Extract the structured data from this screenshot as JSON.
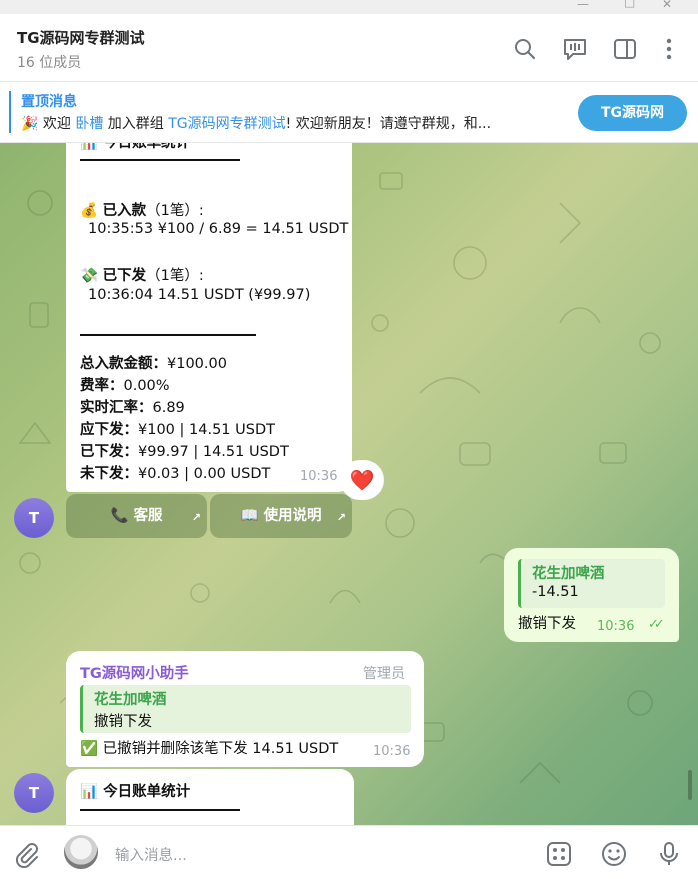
{
  "header": {
    "title": "TG源码网专群测试",
    "subtitle": "16 位成员"
  },
  "pinned": {
    "title": "置顶消息",
    "emoji": "🎉",
    "text_prefix": "欢迎",
    "user": "卧槽",
    "text_mid": "加入群组",
    "group": "TG源码网专群测试",
    "text_suffix": "!   欢迎新朋友！请遵守群规，和...",
    "button": "TG源码网"
  },
  "bill1": {
    "title_partial": "今日账单统计",
    "deposit_emoji": "💰",
    "deposit_label": "已入款",
    "deposit_count": "（1笔）:",
    "deposit_entry": "10:35:53 ¥100 / 6.89 = 14.51 USDT",
    "payout_emoji": "💸",
    "payout_label": "已下发",
    "payout_count": "（1笔）:",
    "payout_entry": "10:36:04 14.51 USDT (¥99.97)",
    "total_label": "总入款金额：",
    "total_value": "¥100.00",
    "rate_label": "费率：",
    "rate_value": "0.00%",
    "fx_label": "实时汇率：",
    "fx_value": "6.89",
    "due_label": "应下发：",
    "due_value": "¥100 | 14.51 USDT",
    "paid_label": "已下发：",
    "paid_value": "¥99.97 | 14.51 USDT",
    "unpaid_label": "未下发：",
    "unpaid_value": "¥0.03 | 0.00 USDT",
    "time": "10:36",
    "reaction": "❤️"
  },
  "keyboard": {
    "service_emoji": "📞",
    "service_label": "客服",
    "manual_emoji": "📖",
    "manual_label": "使用说明"
  },
  "avatar_letter": "T",
  "outgoing": {
    "reply_name": "花生加啤酒",
    "reply_text": "-14.51",
    "text": "撤销下发",
    "time": "10:36",
    "ticks": "✓✓"
  },
  "bot_reply": {
    "sender": "TG源码网小助手",
    "role": "管理员",
    "reply_name": "花生加啤酒",
    "reply_text": "撤销下发",
    "emoji": "✅",
    "text": "已撤销并删除该笔下发 14.51 USDT",
    "time": "10:36"
  },
  "bill2": {
    "emoji": "📊",
    "title": "今日账单统计"
  },
  "input": {
    "placeholder": "输入消息..."
  },
  "colors": {
    "accent": "#3390ec",
    "reply_green": "#3aa54b",
    "sender_purple": "#8a5bd6"
  }
}
